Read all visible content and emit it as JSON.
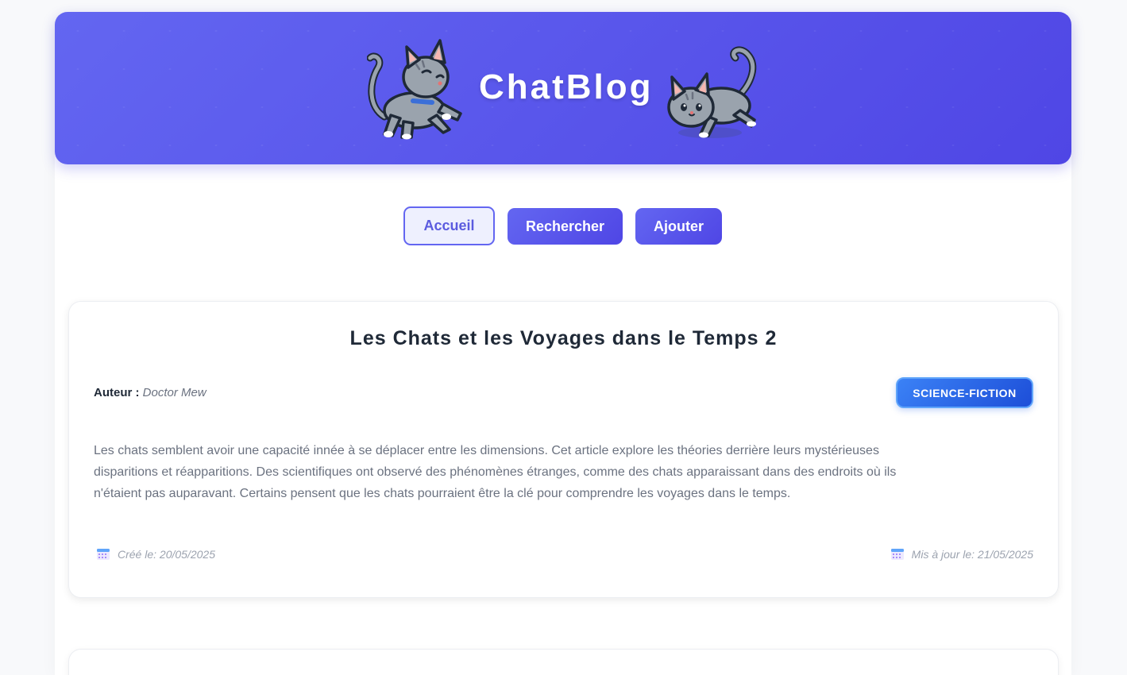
{
  "header": {
    "title": "ChatBlog",
    "gradient_colors": [
      "#6366f1",
      "#4f46e5"
    ]
  },
  "nav": {
    "home_label": "Accueil",
    "search_label": "Rechercher",
    "add_label": "Ajouter"
  },
  "post": {
    "title": "Les Chats et les Voyages dans le Temps 2",
    "author_label": "Auteur :",
    "author_name": "Doctor Mew",
    "category": "SCIENCE-FICTION",
    "body": "Les chats semblent avoir une capacité innée à se déplacer entre les dimensions. Cet article explore les théories derrière leurs mystérieuses disparitions et réapparitions. Des scientifiques ont observé des phénomènes étranges, comme des chats apparaissant dans des endroits où ils n'étaient pas auparavant. Certains pensent que les chats pourraient être la clé pour comprendre les voyages dans le temps.",
    "created": "Créé le: 20/05/2025",
    "updated": "Mis à jour le: 21/05/2025"
  },
  "icons": {
    "created": "calendar-icon",
    "updated": "calendar-icon"
  },
  "colors": {
    "accent": "#6366f1",
    "tag": "#2563eb"
  }
}
